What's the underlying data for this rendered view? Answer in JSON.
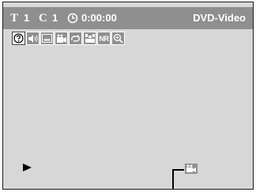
{
  "status": {
    "title_letter": "T",
    "title_number": "1",
    "chapter_letter": "C",
    "chapter_number": "1",
    "time": "0:00:00",
    "disc_type": "DVD-Video"
  },
  "icons": [
    {
      "name": "info-icon",
      "selected": true
    },
    {
      "name": "audio-icon",
      "selected": false
    },
    {
      "name": "subtitle-icon",
      "selected": false
    },
    {
      "name": "angle-icon",
      "selected": false
    },
    {
      "name": "repeat-icon",
      "selected": false
    },
    {
      "name": "surround-icon",
      "selected": false
    },
    {
      "name": "noise-reduction-icon",
      "label": "NR",
      "selected": false
    },
    {
      "name": "zoom-icon",
      "selected": false
    }
  ],
  "playback_state": "play",
  "angle_indicator": "angle-icon",
  "colors": {
    "screen_bg": "#d7d7d7",
    "bar_bg": "#8f8f8f",
    "text": "#ffffff"
  }
}
